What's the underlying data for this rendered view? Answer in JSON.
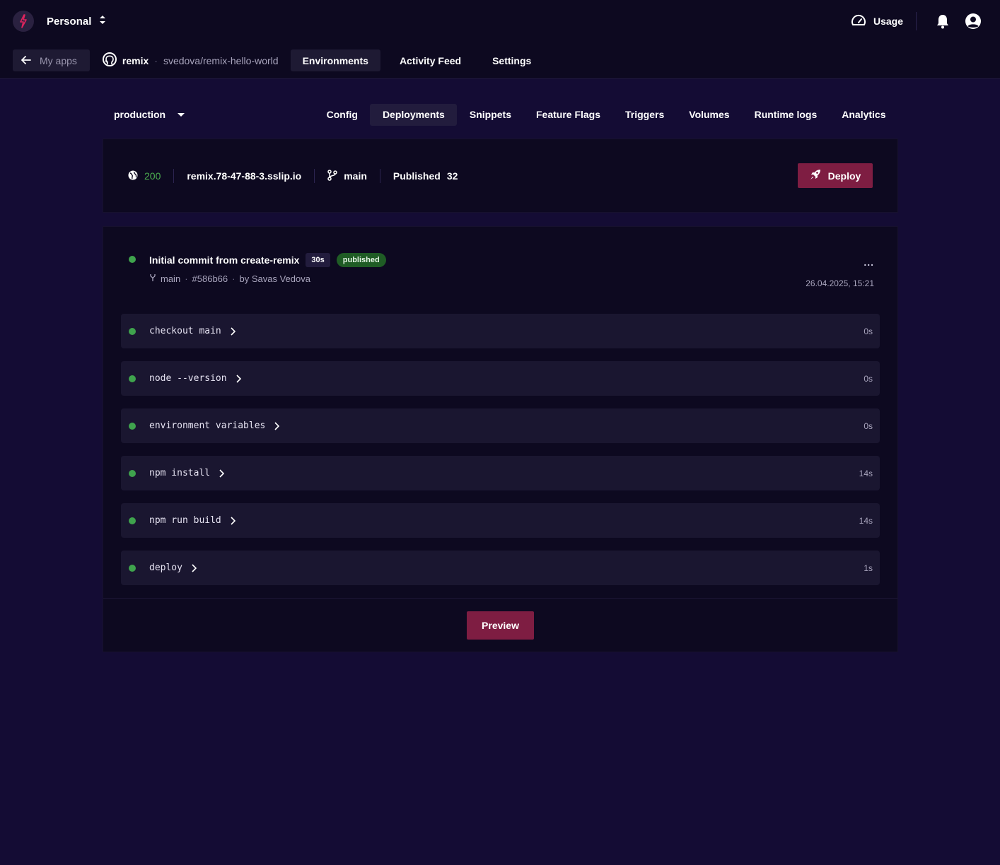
{
  "header": {
    "workspace": "Personal",
    "usage_label": "Usage"
  },
  "subnav": {
    "back_label": "My apps",
    "repo_name": "remix",
    "repo_separator": "·",
    "repo_path": "svedova/remix-hello-world",
    "tabs": [
      "Environments",
      "Activity Feed",
      "Settings"
    ],
    "active_tab": "Environments"
  },
  "environment": {
    "selected": "production",
    "tabs": [
      "Config",
      "Deployments",
      "Snippets",
      "Feature Flags",
      "Triggers",
      "Volumes",
      "Runtime logs",
      "Analytics"
    ],
    "active_tab": "Deployments"
  },
  "status": {
    "code": "200",
    "domain": "remix.78-47-88-3.sslip.io",
    "branch": "main",
    "published_label": "Published",
    "published_count": "32",
    "deploy_label": "Deploy"
  },
  "deployment": {
    "title": "Initial commit from create-remix",
    "duration": "30s",
    "status": "published",
    "branch": "main",
    "commit": "#586b66",
    "author": "by Savas Vedova",
    "meta_separator": "·",
    "more_label": "...",
    "date": "26.04.2025, 15:21",
    "steps": [
      {
        "label": "checkout main",
        "time": "0s"
      },
      {
        "label": "node --version",
        "time": "0s"
      },
      {
        "label": "environment variables",
        "time": "0s"
      },
      {
        "label": "npm install",
        "time": "14s"
      },
      {
        "label": "npm run build",
        "time": "14s"
      },
      {
        "label": "deploy",
        "time": "1s"
      }
    ],
    "preview_label": "Preview"
  },
  "colors": {
    "background": "#140c34",
    "panel": "#0d0920",
    "accent": "#7e1d42",
    "success": "#3fa34d"
  }
}
